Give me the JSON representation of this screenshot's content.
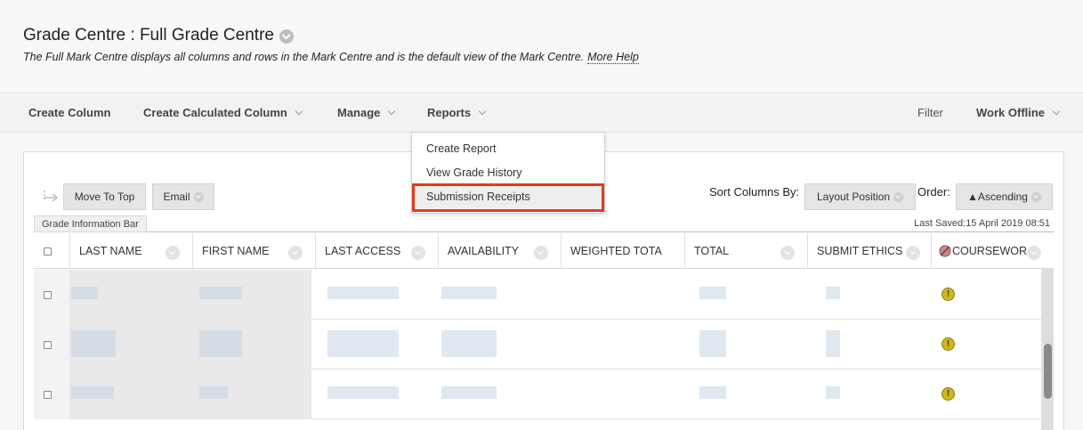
{
  "header": {
    "title": "Grade Centre : Full Grade Centre",
    "description": "The Full Mark Centre displays all columns and rows in the Mark Centre and is the default view of the Mark Centre.",
    "help_link": "More Help"
  },
  "action_bar": {
    "create_column": "Create Column",
    "create_calculated_column": "Create Calculated Column",
    "manage": "Manage",
    "reports": "Reports",
    "filter": "Filter",
    "work_offline": "Work Offline"
  },
  "reports_menu": {
    "items": [
      "Create Report",
      "View Grade History",
      "Submission Receipts"
    ],
    "highlighted": "Submission Receipts"
  },
  "toolbar": {
    "move_to_top": "Move To Top",
    "email": "Email",
    "sort_columns_by_label": "Sort Columns By:",
    "sort_columns_by_value": "Layout Position",
    "order_label": "Order:",
    "order_value": "▲Ascending"
  },
  "grade_bar": {
    "tab_label": "Grade Information Bar",
    "last_saved": "Last Saved:15 April 2019 08:51"
  },
  "grid": {
    "columns": [
      "LAST NAME",
      "FIRST NAME",
      "LAST ACCESS",
      "AVAILABILITY",
      "WEIGHTED TOTA",
      "TOTAL",
      "SUBMIT ETHICS",
      "COURSEWOR"
    ],
    "row_count": 3,
    "status_icon": "needs-marking-icon"
  },
  "colors": {
    "highlight_border": "#e23b1e",
    "status_icon_fill": "#cdb818"
  }
}
